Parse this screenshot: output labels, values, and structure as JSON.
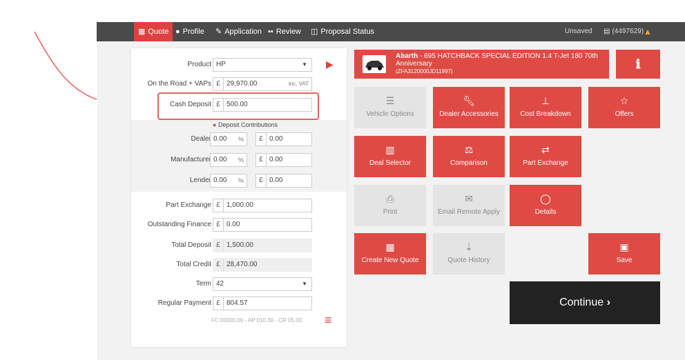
{
  "nav": {
    "quote": "Quote",
    "profile": "Profile",
    "application": "Application",
    "review": "Review",
    "proposal_status": "Proposal Status",
    "unsaved": "Unsaved",
    "ref": "(4497629)"
  },
  "form": {
    "product_label": "Product",
    "product_value": "HP",
    "otr_label": "On the Road + VAPs",
    "otr_value": "29,970.00",
    "otr_suffix": "inc. VAT",
    "cash_label": "Cash Deposit",
    "cash_value": "500.00",
    "contrib_title": "Deposit Contributions",
    "dealer_label": "Dealer",
    "dealer_pct": "0.00",
    "dealer_amt": "0.00",
    "manufacturer_label": "Manufacturer",
    "manufacturer_pct": "0.00",
    "manufacturer_amt": "0.00",
    "lender_label": "Lender",
    "lender_pct": "0.00",
    "lender_amt": "0.00",
    "px_label": "Part Exchange",
    "px_value": "1,000.00",
    "of_label": "Outstanding Finance",
    "of_value": "0.00",
    "td_label": "Total Deposit",
    "td_value": "1,500.00",
    "tc_label": "Total Credit",
    "tc_value": "28,470.00",
    "term_label": "Term",
    "term_value": "42",
    "rp_label": "Regular Payment",
    "rp_value": "804.57",
    "footnote": "FC 00000.00 - AP 010.30 - CR 05.00",
    "pound": "£",
    "pct": "%"
  },
  "vehicle": {
    "make": "Abarth",
    "model": " - 695 HATCHBACK SPECIAL EDITION 1.4 T-Jet 180 70th Anniversary",
    "vin": "(ZFA3120000JD11997)"
  },
  "tiles": {
    "vehicle_options": "Vehicle Options",
    "dealer_accessories": "Dealer Accessories",
    "cost_breakdown": "Cost Breakdown",
    "offers": "Offers",
    "deal_selector": "Deal Selector",
    "comparison": "Comparison",
    "part_exchange": "Part Exchange",
    "print": "Print",
    "email_remote_apply": "Email Remote Apply",
    "details": "Details",
    "create_new_quote": "Create New Quote",
    "quote_history": "Quote History",
    "save": "Save"
  },
  "continue_label": "Continue",
  "colors": {
    "accent": "#e04a44",
    "nav": "#4a4a4a",
    "annotation": "#e7615f"
  }
}
